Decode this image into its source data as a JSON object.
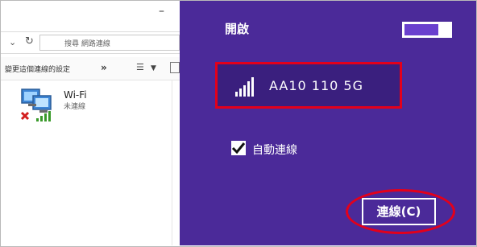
{
  "explorer": {
    "minimize_glyph": "–",
    "search_placeholder": "搜尋 網路連線",
    "toolbar_text": "變更這個連線的設定",
    "toolbar_more": "»",
    "wifi_label": "Wi-Fi",
    "wifi_status": "未連線"
  },
  "flyout": {
    "title": "開啟",
    "toggle_on": true,
    "network_name": "AA10  110  5G",
    "auto_connect_label": "自動連線",
    "auto_connect_checked": true,
    "connect_label": "連線(C)"
  },
  "colors": {
    "flyout_bg": "#4b2a99",
    "highlight_red": "#e3001b",
    "signal_white": "#ffffff"
  },
  "icons": [
    "chevron-down-icon",
    "refresh-icon",
    "view-options-icon",
    "preview-pane-icon",
    "wifi-adapter-icon",
    "wifi-signal-icon",
    "checkbox-checked-icon"
  ]
}
